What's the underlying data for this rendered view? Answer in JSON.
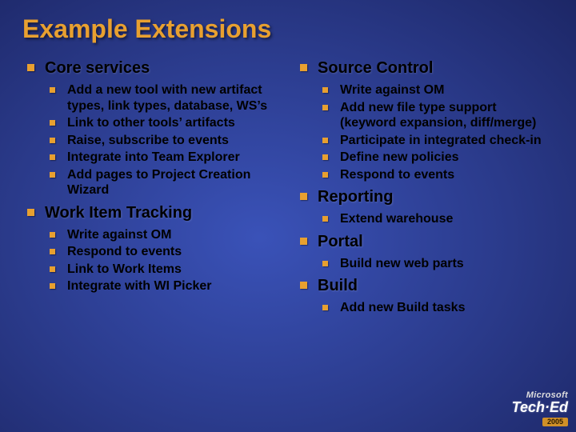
{
  "title": "Example Extensions",
  "left": [
    {
      "heading": "Core services",
      "items": [
        "Add a new tool with new artifact types, link types, database, WS’s",
        "Link to other tools’ artifacts",
        "Raise, subscribe to events",
        "Integrate into Team Explorer",
        "Add pages to Project Creation Wizard"
      ]
    },
    {
      "heading": "Work Item Tracking",
      "items": [
        "Write against OM",
        "Respond to events",
        "Link to Work Items",
        "Integrate with WI Picker"
      ]
    }
  ],
  "right": [
    {
      "heading": "Source Control",
      "items": [
        "Write against OM",
        "Add new file type support (keyword expansion, diff/merge)",
        "Participate in integrated check-in",
        "Define new policies",
        "Respond to events"
      ]
    },
    {
      "heading": "Reporting",
      "items": [
        "Extend warehouse"
      ]
    },
    {
      "heading": "Portal",
      "items": [
        "Build new web parts"
      ]
    },
    {
      "heading": "Build",
      "items": [
        "Add new Build tasks"
      ]
    }
  ],
  "logo": {
    "brand": "Microsoft",
    "product": "Tech·Ed",
    "year": "2005"
  }
}
